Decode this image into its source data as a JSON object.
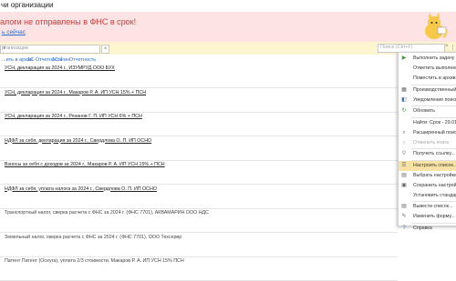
{
  "window": {
    "title": "чи организации"
  },
  "banner": {
    "message": "алоги не отправлены в ФНС в срок!",
    "link": "ь сейчас"
  },
  "toolbar": {
    "select_placeholder": "рганизации",
    "search_placeholder": "Поиск (Ctrl+F)"
  },
  "filters": [
    "...ить в архив",
    "1С-Отчетность",
    "1С:ФинОтчетность"
  ],
  "tasks": [
    {
      "text": "УСН, декларация за 2024 г., ИЗУМРУД ООО БУХ",
      "style": "u"
    },
    {
      "text": "УСН, декларация за 2024 г., Макаров Р. А. ИП УСН 15% + ПСН",
      "style": "u"
    },
    {
      "text": "УСН, декларация за 2024 г., Рязанов Г. П. ИП УСН 6% + ПСН",
      "style": "u"
    },
    {
      "text": "НДФЛ за себя, декларация за 2024 г., Свердлова О. П. ИП ОСНО",
      "style": "u"
    },
    {
      "text": "Взносы за себя с доходов за 2024 г., Макаров Р. А. ИП УСН 15% + ПСН",
      "style": "u"
    },
    {
      "text": "НДФЛ за себя, уплата налога за 2024 г., Свердлова О. П. ИП ОСНО",
      "style": "u"
    },
    {
      "text": "Транспортный налог, сверка расчета с ФНС за 2024 г. (ФНС 7701), АКВАМАРИН ООО НДС",
      "style": "p"
    },
    {
      "text": "Земельный налог, сверка расчета с ФНС за 2024 г. (ФНС 7701), ООО Техсервр",
      "style": "p"
    },
    {
      "text": "Патент Патент (Осеуга), уплата 2/3 стоимости, Макаров Р. А. ИП УСН 15% ПСН",
      "style": "p"
    }
  ],
  "menu": [
    {
      "label": "Выполнить задачу",
      "icon": "play-icon",
      "glyph": "▶",
      "color": "#3aa13a",
      "enabled": true,
      "highlight": false
    },
    {
      "label": "Отметить выполненные",
      "icon": "blank-icon",
      "glyph": "",
      "color": "#999999",
      "enabled": true,
      "highlight": false
    },
    {
      "label": "Поместить в архив",
      "icon": "blank-icon",
      "glyph": "",
      "color": "#999999",
      "enabled": true,
      "highlight": false
    },
    {
      "label": "Производственный кал",
      "icon": "calendar-icon",
      "glyph": "▦",
      "color": "#666666",
      "enabled": true,
      "highlight": false
    },
    {
      "label": "Уведомление поискам",
      "icon": "notify-icon",
      "glyph": "◧",
      "color": "#4a6fb0",
      "enabled": true,
      "highlight": false
    },
    {
      "label": "Обновить",
      "icon": "refresh-icon",
      "glyph": "↻",
      "color": "#3aa13a",
      "enabled": true,
      "highlight": false
    },
    {
      "label": "Найти: Срок - 29.01.20",
      "icon": "blank-icon",
      "glyph": "",
      "color": "#999999",
      "enabled": true,
      "highlight": false
    },
    {
      "label": "Расширенный поиск",
      "icon": "search-icon",
      "glyph": "⌕",
      "color": "#666666",
      "enabled": true,
      "highlight": false
    },
    {
      "label": "Отменить поиск",
      "icon": "cancel-search-icon",
      "glyph": "⌕",
      "color": "#bbbbbb",
      "enabled": false,
      "highlight": false
    },
    {
      "label": "Получить ссылку...",
      "icon": "link-icon",
      "glyph": "⚲",
      "color": "#888888",
      "enabled": true,
      "highlight": false
    },
    {
      "label": "Настроить список...",
      "icon": "list-settings-icon",
      "glyph": "☰",
      "color": "#666666",
      "enabled": true,
      "highlight": true
    },
    {
      "label": "Выбрать настройки...",
      "icon": "settings-icon",
      "glyph": "▤",
      "color": "#666666",
      "enabled": true,
      "highlight": false
    },
    {
      "label": "Сохранить настройки",
      "icon": "save-icon",
      "glyph": "▣",
      "color": "#666666",
      "enabled": true,
      "highlight": false
    },
    {
      "label": "Установить стандартн",
      "icon": "blank-icon",
      "glyph": "",
      "color": "#999999",
      "enabled": true,
      "highlight": false
    },
    {
      "label": "Вывести список...",
      "icon": "print-icon",
      "glyph": "▤",
      "color": "#666666",
      "enabled": true,
      "highlight": false
    },
    {
      "label": "Изменить форму...",
      "icon": "form-edit-icon",
      "glyph": "✎",
      "color": "#666666",
      "enabled": true,
      "highlight": false
    },
    {
      "label": "Справка",
      "icon": "help-icon",
      "glyph": "?",
      "color": "#3a6fc0",
      "enabled": true,
      "highlight": false
    }
  ]
}
